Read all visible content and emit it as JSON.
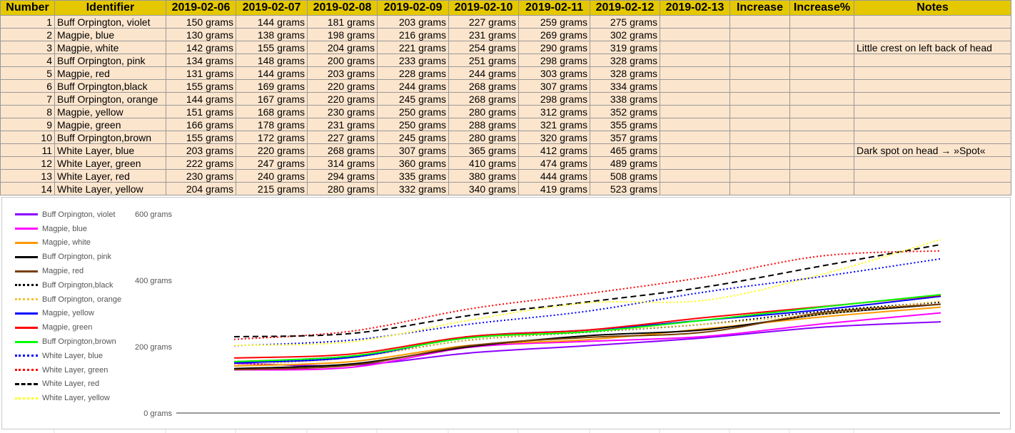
{
  "table": {
    "headers": [
      "Number",
      "Identifier",
      "2019-02-06",
      "2019-02-07",
      "2019-02-08",
      "2019-02-09",
      "2019-02-10",
      "2019-02-11",
      "2019-02-12",
      "2019-02-13",
      "Increase",
      "Increase%",
      "Notes"
    ],
    "rows": [
      {
        "num": "1",
        "id": "Buff Orpington, violet",
        "w": [
          "150 grams",
          "144 grams",
          "181 grams",
          "203 grams",
          "227 grams",
          "259 grams",
          "275 grams"
        ],
        "note": ""
      },
      {
        "num": "2",
        "id": "Magpie, blue",
        "w": [
          "130 grams",
          "138 grams",
          "198 grams",
          "216 grams",
          "231 grams",
          "269 grams",
          "302 grams"
        ],
        "note": ""
      },
      {
        "num": "3",
        "id": "Magpie, white",
        "w": [
          "142 grams",
          "155 grams",
          "204 grams",
          "221 grams",
          "254 grams",
          "290 grams",
          "319 grams"
        ],
        "note": "Little crest on left back of head"
      },
      {
        "num": "4",
        "id": "Buff Orpington, pink",
        "w": [
          "134 grams",
          "148 grams",
          "200 grams",
          "233 grams",
          "251 grams",
          "298 grams",
          "328 grams"
        ],
        "note": ""
      },
      {
        "num": "5",
        "id": "Magpie, red",
        "w": [
          "131 grams",
          "144 grams",
          "203 grams",
          "228 grams",
          "244 grams",
          "303 grams",
          "328 grams"
        ],
        "note": ""
      },
      {
        "num": "6",
        "id": "Buff Orpington,black",
        "w": [
          "155 grams",
          "169 grams",
          "220 grams",
          "244 grams",
          "268 grams",
          "307 grams",
          "334 grams"
        ],
        "note": ""
      },
      {
        "num": "7",
        "id": "Buff Orpington, orange",
        "w": [
          "144 grams",
          "167 grams",
          "220 grams",
          "245 grams",
          "268 grams",
          "298 grams",
          "338 grams"
        ],
        "note": ""
      },
      {
        "num": "8",
        "id": "Magpie, yellow",
        "w": [
          "151 grams",
          "168 grams",
          "230 grams",
          "250 grams",
          "280 grams",
          "312 grams",
          "352 grams"
        ],
        "note": ""
      },
      {
        "num": "9",
        "id": "Magpie, green",
        "w": [
          "166 grams",
          "178 grams",
          "231 grams",
          "250 grams",
          "288 grams",
          "321 grams",
          "355 grams"
        ],
        "note": ""
      },
      {
        "num": "10",
        "id": "Buff Orpington,brown",
        "w": [
          "155 grams",
          "172 grams",
          "227 grams",
          "245 grams",
          "280 grams",
          "320 grams",
          "357 grams"
        ],
        "note": ""
      },
      {
        "num": "11",
        "id": "White Layer, blue",
        "w": [
          "203 grams",
          "220 grams",
          "268 grams",
          "307 grams",
          "365 grams",
          "412 grams",
          "465 grams"
        ],
        "note": "Dark spot on head → »Spot«"
      },
      {
        "num": "12",
        "id": "White Layer, green",
        "w": [
          "222 grams",
          "247 grams",
          "314 grams",
          "360 grams",
          "410 grams",
          "474 grams",
          "489 grams"
        ],
        "note": ""
      },
      {
        "num": "13",
        "id": "White Layer, red",
        "w": [
          "230 grams",
          "240 grams",
          "294 grams",
          "335 grams",
          "380 grams",
          "444 grams",
          "508 grams"
        ],
        "note": ""
      },
      {
        "num": "14",
        "id": "White Layer, yellow",
        "w": [
          "204 grams",
          "215 grams",
          "280 grams",
          "332 grams",
          "340 grams",
          "419 grams",
          "523 grams"
        ],
        "note": ""
      }
    ]
  },
  "chart_data": {
    "type": "line",
    "x": [
      "2019-02-06",
      "2019-02-07",
      "2019-02-08",
      "2019-02-09",
      "2019-02-10",
      "2019-02-11",
      "2019-02-12"
    ],
    "ylim": [
      0,
      600
    ],
    "yticks": [
      0,
      200,
      400,
      600
    ],
    "ytick_labels": [
      "0 grams",
      "200 grams",
      "400 grams",
      "600 grams"
    ],
    "legend_position": "left",
    "series": [
      {
        "name": "Buff Orpington, violet",
        "color": "#8B00FF",
        "dash": "solid",
        "values": [
          150,
          144,
          181,
          203,
          227,
          259,
          275
        ]
      },
      {
        "name": "Magpie, blue",
        "color": "#FF00FF",
        "dash": "solid",
        "values": [
          130,
          138,
          198,
          216,
          231,
          269,
          302
        ]
      },
      {
        "name": "Magpie, white",
        "color": "#FF9900",
        "dash": "solid",
        "values": [
          142,
          155,
          204,
          221,
          254,
          290,
          319
        ]
      },
      {
        "name": "Buff Orpington, pink",
        "color": "#000000",
        "dash": "solid",
        "values": [
          134,
          148,
          200,
          233,
          251,
          298,
          328
        ]
      },
      {
        "name": "Magpie, red",
        "color": "#783F04",
        "dash": "solid",
        "values": [
          131,
          144,
          203,
          228,
          244,
          303,
          328
        ]
      },
      {
        "name": "Buff Orpington,black",
        "color": "#000000",
        "dash": "dotted",
        "values": [
          155,
          169,
          220,
          244,
          268,
          307,
          334
        ]
      },
      {
        "name": "Buff Orpington, orange",
        "color": "#F1C232",
        "dash": "dotted",
        "values": [
          144,
          167,
          220,
          245,
          268,
          298,
          338
        ]
      },
      {
        "name": "Magpie, yellow",
        "color": "#0000FF",
        "dash": "solid",
        "values": [
          151,
          168,
          230,
          250,
          280,
          312,
          352
        ]
      },
      {
        "name": "Magpie, green",
        "color": "#FF0000",
        "dash": "solid",
        "values": [
          166,
          178,
          231,
          250,
          288,
          321,
          355
        ]
      },
      {
        "name": "Buff Orpington,brown",
        "color": "#00FF00",
        "dash": "solid",
        "values": [
          155,
          172,
          227,
          245,
          280,
          320,
          357
        ]
      },
      {
        "name": "White Layer, blue",
        "color": "#0000FF",
        "dash": "dotted",
        "values": [
          203,
          220,
          268,
          307,
          365,
          412,
          465
        ]
      },
      {
        "name": "White Layer, green",
        "color": "#FF0000",
        "dash": "dotted",
        "values": [
          222,
          247,
          314,
          360,
          410,
          474,
          489
        ]
      },
      {
        "name": "White Layer, red",
        "color": "#000000",
        "dash": "dashed",
        "values": [
          230,
          240,
          294,
          335,
          380,
          444,
          508
        ]
      },
      {
        "name": "White Layer, yellow",
        "color": "#FFFF00",
        "dash": "dotted",
        "values": [
          204,
          215,
          280,
          332,
          340,
          419,
          523
        ]
      }
    ]
  }
}
